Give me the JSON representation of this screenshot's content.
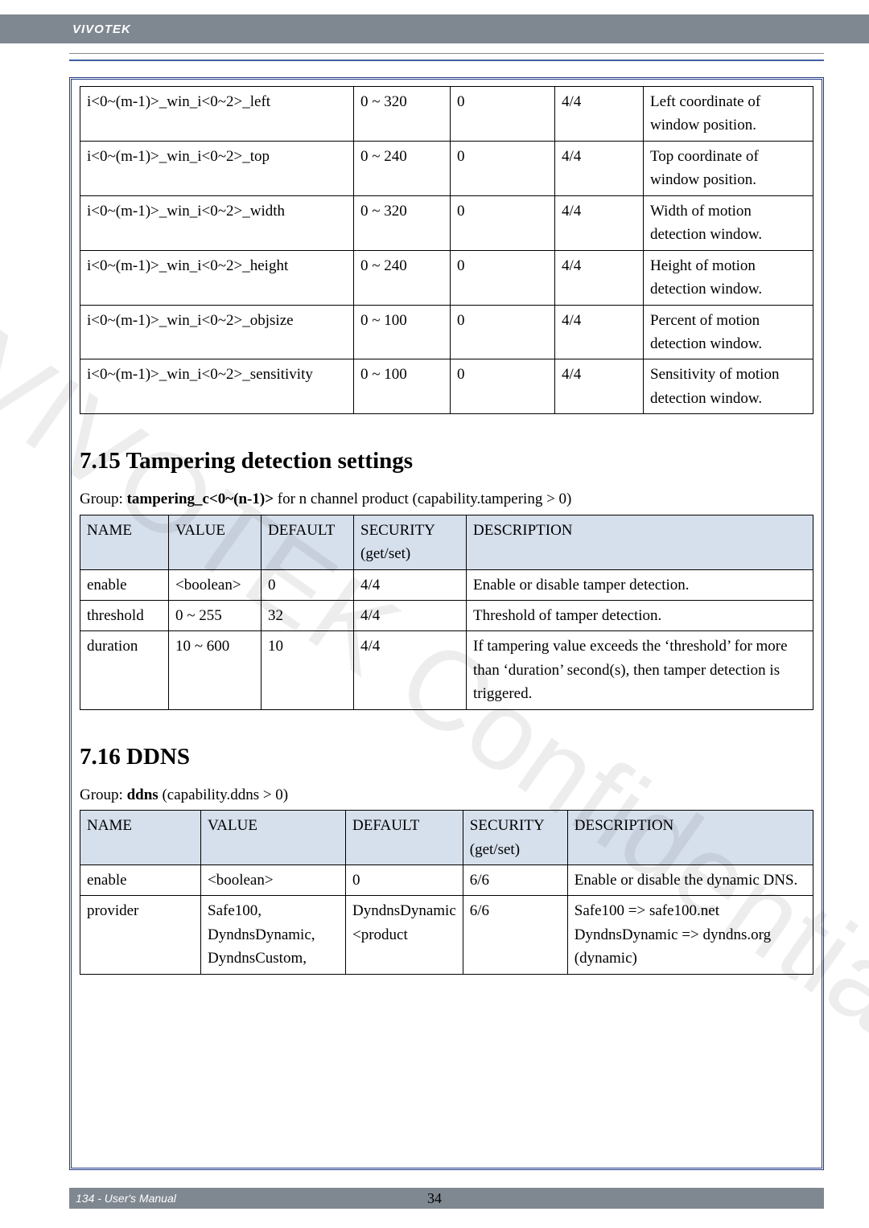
{
  "brand": "VIVOTEK",
  "footer": "134 - User's Manual",
  "center_pg": "34",
  "watermark": "VIVOTEK Confidential",
  "table1": {
    "rows": [
      {
        "name": "i<0~(m-1)>_win_i<0~2>_left",
        "value": "0 ~ 320",
        "default": "0",
        "security": "4/4",
        "desc": "Left coordinate of window position."
      },
      {
        "name": "i<0~(m-1)>_win_i<0~2>_top",
        "value": "0 ~ 240",
        "default": "0",
        "security": "4/4",
        "desc": "Top coordinate of window position."
      },
      {
        "name": "i<0~(m-1)>_win_i<0~2>_width",
        "value": "0 ~ 320",
        "default": "0",
        "security": "4/4",
        "desc": "Width of motion detection window."
      },
      {
        "name": "i<0~(m-1)>_win_i<0~2>_height",
        "value": "0 ~ 240",
        "default": "0",
        "security": "4/4",
        "desc": "Height of motion detection window."
      },
      {
        "name": "i<0~(m-1)>_win_i<0~2>_objsize",
        "value": "0 ~ 100",
        "default": "0",
        "security": "4/4",
        "desc": "Percent of motion detection window."
      },
      {
        "name": "i<0~(m-1)>_win_i<0~2>_sensitivity",
        "value": "0 ~ 100",
        "default": "0",
        "security": "4/4",
        "desc": "Sensitivity of motion detection window."
      }
    ]
  },
  "section715": {
    "heading": "7.15 Tampering detection settings",
    "group_prefix": "Group: ",
    "group_bold": "tampering_c<0~(n-1)>",
    "group_suffix": " for n channel product (capability.tampering > 0)",
    "headers": {
      "name": "NAME",
      "value": "VALUE",
      "default": "DEFAULT",
      "security": "SECURITY (get/set)",
      "desc": "DESCRIPTION"
    },
    "rows": [
      {
        "name": "enable",
        "value": "<boolean>",
        "default": "0",
        "security": "4/4",
        "desc": "Enable or disable tamper detection."
      },
      {
        "name": "threshold",
        "value": "0 ~ 255",
        "default": "32",
        "security": "4/4",
        "desc": "Threshold of tamper detection."
      },
      {
        "name": "duration",
        "value": "10 ~ 600",
        "default": "10",
        "security": "4/4",
        "desc": "If tampering value exceeds the ‘threshold’ for more than ‘duration’ second(s), then tamper detection is triggered."
      }
    ]
  },
  "section716": {
    "heading": "7.16 DDNS",
    "group_prefix": "Group: ",
    "group_bold": "ddns",
    "group_suffix": " (capability.ddns > 0)",
    "headers": {
      "name": "NAME",
      "value": "VALUE",
      "default": "DEFAULT",
      "security": "SECURITY (get/set)",
      "desc": "DESCRIPTION"
    },
    "rows": [
      {
        "name": "enable",
        "value": "<boolean>",
        "default": "0",
        "security": "6/6",
        "desc": "Enable or disable the dynamic DNS."
      },
      {
        "name": "provider",
        "value": "Safe100, DyndnsDynamic, DyndnsCustom,",
        "default": "DyndnsDynamic <product",
        "security": "6/6",
        "desc": "Safe100 => safe100.net\nDyndnsDynamic => dyndns.org (dynamic)"
      }
    ]
  }
}
